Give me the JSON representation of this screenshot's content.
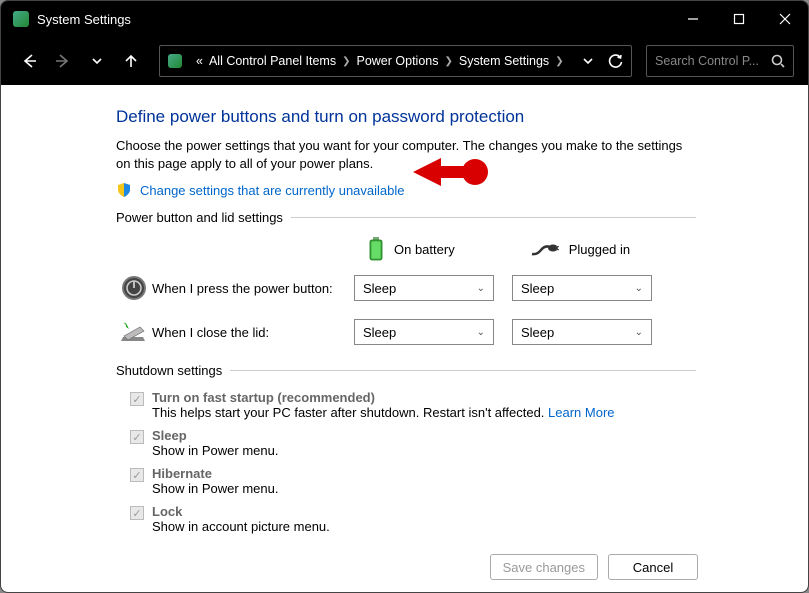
{
  "window": {
    "title": "System Settings"
  },
  "breadcrumb": {
    "prefix": "«",
    "items": [
      "All Control Panel Items",
      "Power Options",
      "System Settings"
    ]
  },
  "search": {
    "placeholder": "Search Control P..."
  },
  "page": {
    "heading": "Define power buttons and turn on password protection",
    "subtext": "Choose the power settings that you want for your computer. The changes you make to the settings on this page apply to all of your power plans.",
    "change_link": "Change settings that are currently unavailable"
  },
  "section1": {
    "title": "Power button and lid settings",
    "col_battery": "On battery",
    "col_plugged": "Plugged in",
    "rows": [
      {
        "label": "When I press the power button:",
        "battery": "Sleep",
        "plugged": "Sleep"
      },
      {
        "label": "When I close the lid:",
        "battery": "Sleep",
        "plugged": "Sleep"
      }
    ]
  },
  "section2": {
    "title": "Shutdown settings",
    "items": [
      {
        "title": "Turn on fast startup (recommended)",
        "desc_prefix": "This helps start your PC faster after shutdown. Restart isn't affected. ",
        "link": "Learn More"
      },
      {
        "title": "Sleep",
        "desc": "Show in Power menu."
      },
      {
        "title": "Hibernate",
        "desc": "Show in Power menu."
      },
      {
        "title": "Lock",
        "desc": "Show in account picture menu."
      }
    ]
  },
  "footer": {
    "save": "Save changes",
    "cancel": "Cancel"
  }
}
